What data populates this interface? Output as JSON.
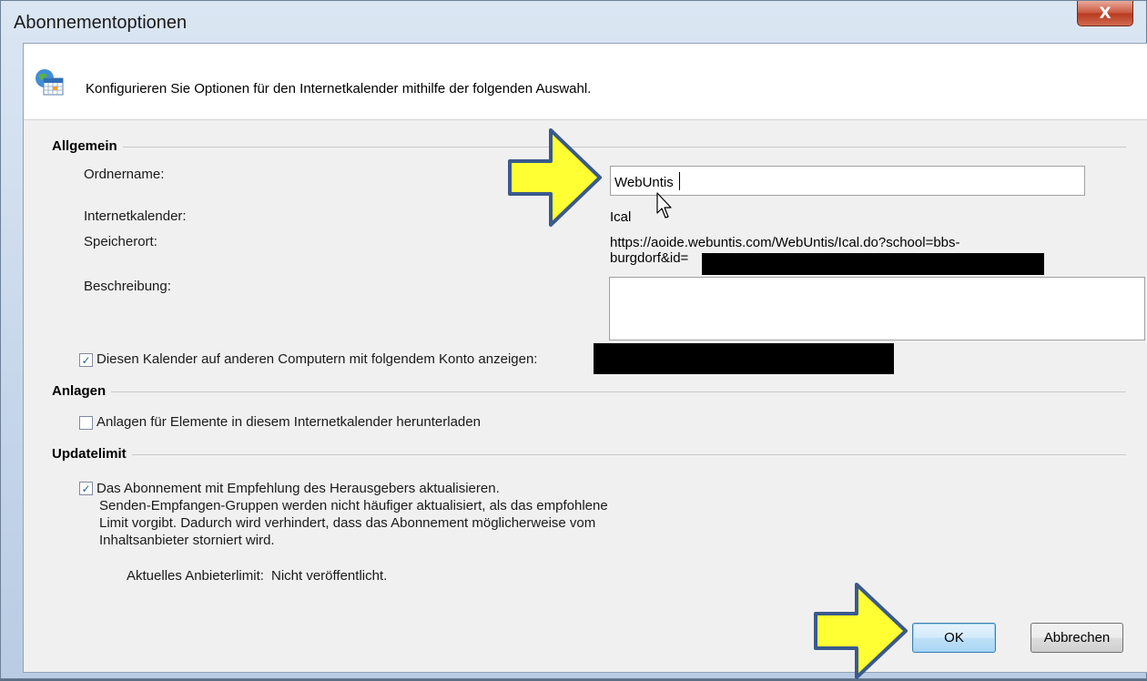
{
  "window": {
    "title": "Abonnementoptionen",
    "close_glyph": "X"
  },
  "header": {
    "text": "Konfigurieren Sie Optionen für den Internetkalender mithilfe der folgenden Auswahl.",
    "icon": "calendar-globe-icon"
  },
  "sections": {
    "allgemein": "Allgemein",
    "anlagen": "Anlagen",
    "updatelimit": "Updatelimit"
  },
  "general": {
    "folder_label": "Ordnername:",
    "folder_value": "WebUntis",
    "calendar_label": "Internetkalender:",
    "calendar_value": "Ical",
    "location_label": "Speicherort:",
    "location_line1": "https://aoide.webuntis.com/WebUntis/Ical.do?school=bbs-",
    "location_line2": "burgdorf&id=",
    "description_label": "Beschreibung:",
    "description_value": "",
    "show_other_label": "Diesen Kalender auf anderen Computern mit folgendem Konto anzeigen:",
    "show_other_checked": true
  },
  "attachments": {
    "download_label": "Anlagen für Elemente in diesem Internetkalender herunterladen",
    "download_checked": false
  },
  "update": {
    "publisher_label_line1": "Das Abonnement mit Empfehlung des Herausgebers aktualisieren.",
    "publisher_label_line2": "Senden-Empfangen-Gruppen werden nicht häufiger aktualisiert, als das empfohlene",
    "publisher_label_line3": "Limit vorgibt. Dadurch wird verhindert, dass das Abonnement möglicherweise vom",
    "publisher_label_line4": "Inhaltsanbieter storniert wird.",
    "publisher_checked": true,
    "current_limit_label": "Aktuelles Anbieterlimit:",
    "current_limit_value": "Nicht veröffentlicht."
  },
  "buttons": {
    "ok": "OK",
    "cancel": "Abbrechen"
  },
  "colors": {
    "arrow_fill": "#ffff33",
    "arrow_stroke": "#3a5a8c",
    "redaction": "#000000"
  }
}
